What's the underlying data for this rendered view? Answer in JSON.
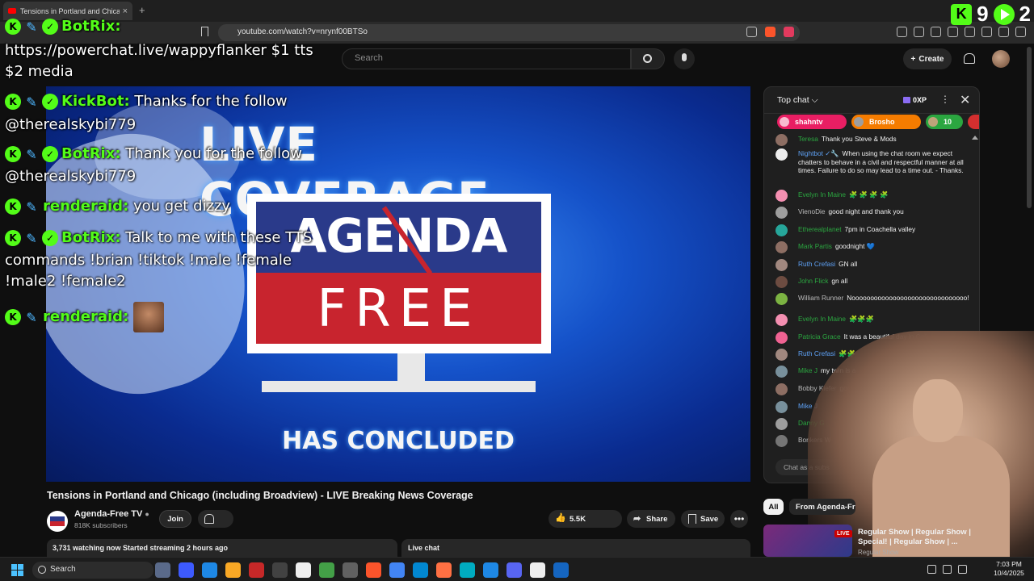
{
  "browser": {
    "tab_title": "Tensions in Portland and Chicago",
    "tab_close": "×",
    "new_tab": "+",
    "url": "youtube.com/watch?v=nrynf00BTSo"
  },
  "counters": {
    "kick_count": "9",
    "kick_glyph": "K",
    "play_count": "2"
  },
  "youtube": {
    "search_placeholder": "Search",
    "create_label": "Create",
    "create_plus": "+"
  },
  "overlay": {
    "messages": [
      {
        "name": "BotRix:",
        "text": ""
      },
      {
        "name": "",
        "text": "https://powerchat.live/wappyflanker $1 tts"
      },
      {
        "name": "",
        "text": "$2 media"
      },
      {
        "name": "KickBot:",
        "text": " Thanks for the follow"
      },
      {
        "name": "",
        "text": "@therealskybi779"
      },
      {
        "name": "BotRix:",
        "text": " Thank you for the follow"
      },
      {
        "name": "",
        "text": "@therealskybi779"
      },
      {
        "name": "renderaid:",
        "text": " you get dizzy"
      },
      {
        "name": "BotRix:",
        "text": " Talk to me with these TTS"
      },
      {
        "name": "",
        "text": "commands !brian !tiktok !male !female"
      },
      {
        "name": "",
        "text": "!male2 !female2"
      },
      {
        "name": "renderaid:",
        "text": ""
      }
    ],
    "badge_kick": "K",
    "badge_sword": "✎",
    "badge_check": "✓",
    "yt_logo": "YouTube"
  },
  "video": {
    "top_text": "LIVE COVERAGE",
    "screen_top": "AGENDA",
    "screen_bottom": "FREE",
    "bottom_text": "HAS CONCLUDED"
  },
  "below_video": {
    "title": "Tensions in Portland and Chicago (including Broadview) - LIVE Breaking News Coverage",
    "channel_name": "Agenda-Free TV",
    "verified": "●",
    "subscribers": "818K subscribers",
    "join_label": "Join",
    "likes": "5.5K",
    "share_label": "Share",
    "save_label": "Save",
    "more_label": "•••",
    "stats": "3,731 watching now  Started streaming 2 hours ago",
    "live_chat_label": "Live chat"
  },
  "chat": {
    "header": "Top chat ⌵",
    "xp": "0XP",
    "dots": "⋮",
    "close": "✕",
    "tickers": [
      {
        "name": "shahntv",
        "color": "#e91e63"
      },
      {
        "name": "Brosho",
        "color": "#f57c00"
      },
      {
        "name": "10",
        "color": "#2ba640"
      }
    ],
    "messages": [
      {
        "name": "Teresa",
        "text": "Thank you Steve & Mods",
        "cls": "green",
        "av": "#8d6e63"
      },
      {
        "name": "Nightbot ✓🔧",
        "text": "When using the chat room we expect chatters to behave in a civil and respectful manner at all times. Failure to do so may lead to a time out. - Thanks.",
        "cls": "",
        "av": "#eeeeee"
      },
      {
        "name": "Evelyn In Maine",
        "text": "🧩 🧩 🧩 🧩",
        "cls": "green",
        "av": "#f48fb1"
      },
      {
        "name": "VienoDie",
        "text": "good night and thank you",
        "cls": "plain",
        "av": "#9e9e9e"
      },
      {
        "name": "Etherealplanet",
        "text": "7pm in Coachella valley",
        "cls": "green",
        "av": "#26a69a"
      },
      {
        "name": "Mark Partis",
        "text": "goodnight 💙",
        "cls": "green",
        "av": "#8d6e63"
      },
      {
        "name": "Ruth Crefasi",
        "text": "GN all",
        "cls": "",
        "av": "#a1887f"
      },
      {
        "name": "John Flick",
        "text": "gn all",
        "cls": "green",
        "av": "#6d4c41"
      },
      {
        "name": "William Runner",
        "text": "Nooooooooooooooooooooooooooooooo!",
        "cls": "plain",
        "av": "#7cb342"
      },
      {
        "name": "Evelyn In Maine",
        "text": "🧩🧩🧩",
        "cls": "green",
        "av": "#f48fb1"
      },
      {
        "name": "Patricia Grace",
        "text": "It was a beautiful day in Cali",
        "cls": "green",
        "av": "#f06292"
      },
      {
        "name": "Ruth Crefasi",
        "text": "🧩🧩",
        "cls": "",
        "av": "#a1887f"
      },
      {
        "name": "Mike J",
        "text": "my twin is a",
        "cls": "green",
        "av": "#78909c"
      },
      {
        "name": "Bobby Kiefer",
        "text": "goo",
        "cls": "plain",
        "av": "#8d6e63"
      },
      {
        "name": "Mike J",
        "text": "",
        "cls": "",
        "av": "#78909c"
      },
      {
        "name": "Danny G",
        "text": "",
        "cls": "green",
        "av": "#9e9e9e"
      },
      {
        "name": "Bonkers W",
        "text": "",
        "cls": "plain",
        "av": "#757575"
      }
    ],
    "input_placeholder": "Chat as a subs"
  },
  "recommendations": {
    "chip_all": "All",
    "chip_from": "From Agenda-Fr",
    "live_tag": "LIVE",
    "title": "Regular Show | Regular Show | Special! | Regular Show | ...",
    "channel": "Regular Show"
  },
  "taskbar": {
    "search_label": "Search",
    "time": "7:03 PM",
    "date": "10/4/2025"
  }
}
